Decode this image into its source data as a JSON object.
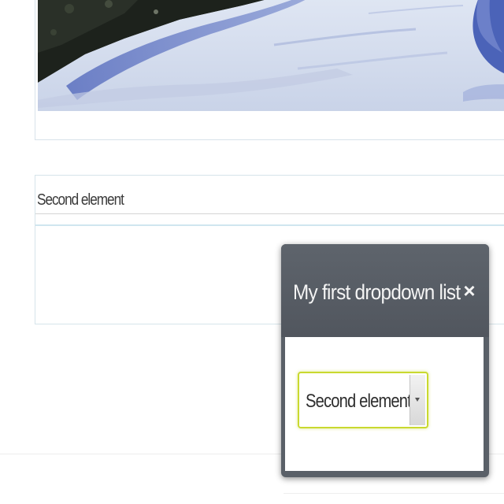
{
  "panel": {
    "header_label": "Second element"
  },
  "dialog": {
    "title": "My first dropdown list",
    "close_label": "×",
    "select": {
      "selected_value": "Second element"
    }
  },
  "icons": {
    "close": "close-icon",
    "dropdown": "chevron-down-icon"
  },
  "colors": {
    "dialog_titlebar": "#5a6068",
    "select_focus_border": "#c9d92f",
    "panel_border": "#d6e4ea"
  }
}
